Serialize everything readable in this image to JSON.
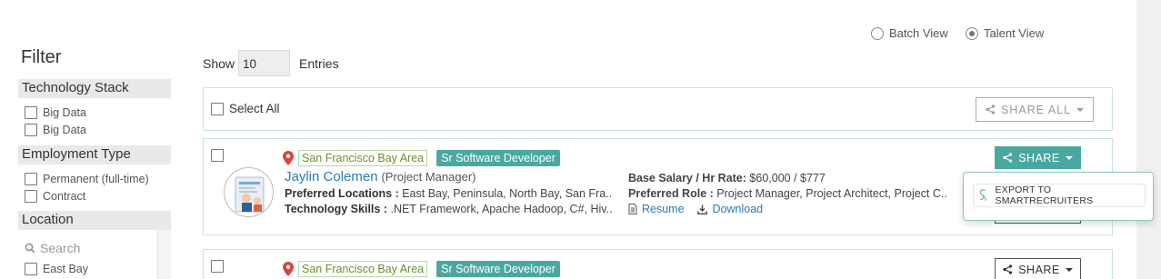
{
  "view_toggle": {
    "batch_label": "Batch View",
    "talent_label": "Talent View",
    "selected": "Talent View"
  },
  "filter": {
    "title": "Filter",
    "sections": [
      {
        "title": "Technology Stack",
        "options": [
          "Big Data",
          "Big Data"
        ]
      },
      {
        "title": "Employment Type",
        "options": [
          "Permanent (full-time)",
          "Contract"
        ]
      },
      {
        "title": "Location",
        "search_placeholder": "Search",
        "options": [
          "East Bay"
        ]
      }
    ]
  },
  "entries": {
    "show_label": "Show",
    "value": "10",
    "entries_label": "Entries"
  },
  "select_bar": {
    "select_all_label": "Select All",
    "share_all_label": "SHARE ALL"
  },
  "cards": [
    {
      "location": "San Francisco Bay Area",
      "role": "Sr Software Developer",
      "name": "Jaylin Colemen",
      "title": "(Project Manager)",
      "preferred_locations_label": "Preferred Locations :",
      "preferred_locations": "East Bay, Peninsula, North Bay, San Fra...",
      "tech_skills_label": "Technology Skills :",
      "tech_skills": ".NET Framework, Apache Hadoop, C#, Hiv...",
      "salary_label": "Base Salary / Hr Rate:",
      "salary": "$60,000 / $777",
      "preferred_role_label": "Preferred Role :",
      "preferred_role": "Project Manager, Project Architect, Project C...",
      "resume_label": "Resume",
      "download_label": "Download",
      "share_label": "SHARE"
    },
    {
      "location": "San Francisco Bay Area",
      "role": "Sr Software Developer",
      "share_label": "SHARE"
    }
  ],
  "share_menu": {
    "items": [
      "EXPORT TO SMARTRECRUITERS"
    ]
  },
  "colors": {
    "accent": "#4aa8a0",
    "link": "#2a7ab8",
    "location_tag": "#6a8f2a",
    "pin": "#d9453a"
  }
}
